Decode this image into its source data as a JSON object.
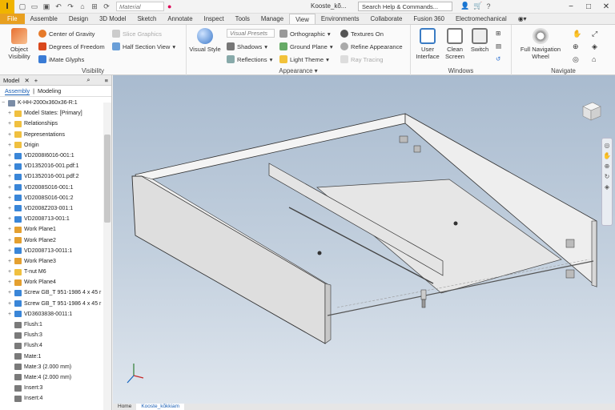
{
  "titlebar": {
    "app_letter": "I",
    "material_placeholder": "Material",
    "doc_title": "Kooste_kõ...",
    "search_label": "Search Help & Commands..."
  },
  "tabs": [
    {
      "label": "File"
    },
    {
      "label": "Assemble"
    },
    {
      "label": "Design"
    },
    {
      "label": "3D Model"
    },
    {
      "label": "Sketch"
    },
    {
      "label": "Annotate"
    },
    {
      "label": "Inspect"
    },
    {
      "label": "Tools"
    },
    {
      "label": "Manage"
    },
    {
      "label": "View"
    },
    {
      "label": "Environments"
    },
    {
      "label": "Collaborate"
    },
    {
      "label": "Fusion 360"
    },
    {
      "label": "Electromechanical"
    }
  ],
  "ribbon": {
    "visibility": {
      "label": "Visibility",
      "object_visibility": "Object Visibility",
      "center_of_gravity": "Center of Gravity",
      "degrees_of_freedom": "Degrees of Freedom",
      "imate_glyphs": "iMate Glyphs",
      "slice_graphics": "Slice Graphics",
      "half_section_view": "Half Section View"
    },
    "appearance": {
      "label": "Appearance",
      "visual_style": "Visual Style",
      "visual_presets": "Visual Presets",
      "shadows": "Shadows",
      "reflections": "Reflections",
      "orthographic": "Orthographic",
      "ground_plane": "Ground Plane",
      "light_theme": "Light Theme",
      "textures_on": "Textures On",
      "refine_appearance": "Refine Appearance",
      "ray_tracing": "Ray Tracing"
    },
    "windows": {
      "label": "Windows",
      "user_interface": "User Interface",
      "clean_screen": "Clean Screen",
      "switch": "Switch"
    },
    "navigate": {
      "label": "Navigate",
      "full_navigation_wheel": "Full Navigation Wheel"
    }
  },
  "browser": {
    "title": "Model",
    "tab_assembly": "Assembly",
    "tab_modeling": "Modeling",
    "root": "K-HH-2000x360x36-R:1",
    "items": [
      {
        "label": "Model States: [Primary]",
        "icon": "folder"
      },
      {
        "label": "Relationships",
        "icon": "folder"
      },
      {
        "label": "Representations",
        "icon": "folder"
      },
      {
        "label": "Origin",
        "icon": "folder"
      },
      {
        "label": "VD2008I6016-001:1",
        "icon": "part"
      },
      {
        "label": "VD1352016-001.pdf:1",
        "icon": "part"
      },
      {
        "label": "VD1352016-001.pdf:2",
        "icon": "part"
      },
      {
        "label": "VD2008S016-001:1",
        "icon": "part"
      },
      {
        "label": "VD2008S016-001:2",
        "icon": "part"
      },
      {
        "label": "VD2008Z203-001:1",
        "icon": "part"
      },
      {
        "label": "VD2008713-001:1",
        "icon": "part"
      },
      {
        "label": "Work Plane1",
        "icon": "plane"
      },
      {
        "label": "Work Plane2",
        "icon": "plane"
      },
      {
        "label": "VD2008713-0011:1",
        "icon": "part"
      },
      {
        "label": "Work Plane3",
        "icon": "plane"
      },
      {
        "label": "T-nut M6",
        "icon": "folder"
      },
      {
        "label": "Work Plane4",
        "icon": "plane"
      },
      {
        "label": "Screw GB_T 951-1986 4 x 45 r",
        "icon": "part"
      },
      {
        "label": "Screw GB_T 951-1986 4 x 45 r",
        "icon": "part"
      },
      {
        "label": "VD3603838-0011:1",
        "icon": "part"
      },
      {
        "label": "Flush:1",
        "icon": "constraint"
      },
      {
        "label": "Flush:3",
        "icon": "constraint"
      },
      {
        "label": "Flush:4",
        "icon": "constraint"
      },
      {
        "label": "Mate:1",
        "icon": "constraint"
      },
      {
        "label": "Mate:3 (2.000 mm)",
        "icon": "constraint"
      },
      {
        "label": "Mate:4 (2.000 mm)",
        "icon": "constraint"
      },
      {
        "label": "Insert:3",
        "icon": "constraint"
      },
      {
        "label": "Insert:4",
        "icon": "constraint"
      }
    ]
  },
  "doctabs": {
    "home": "Home",
    "active": "Kooste_kõkkiam"
  },
  "colors": {
    "file_tab": "#e8a020",
    "accent": "#1a5fb4",
    "viewport_top": "#a9bbcf",
    "viewport_bottom": "#dfe6ee"
  }
}
